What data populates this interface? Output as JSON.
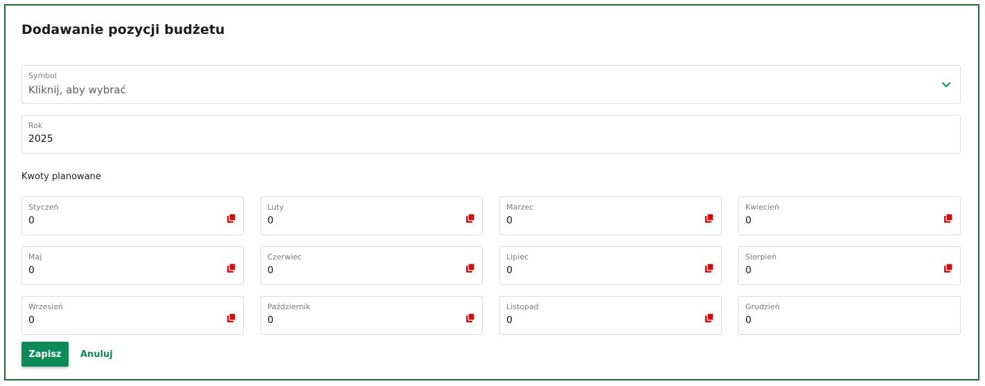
{
  "form": {
    "title": "Dodawanie pozycji budżetu",
    "symbol": {
      "label": "Symbol",
      "placeholder": "Kliknij, aby wybrać"
    },
    "year": {
      "label": "Rok",
      "value": "2025"
    },
    "section_title": "Kwoty planowane",
    "months": [
      {
        "label": "Styczeń",
        "value": "0",
        "copy_icon": "copy-icon"
      },
      {
        "label": "Luty",
        "value": "0",
        "copy_icon": "copy-icon"
      },
      {
        "label": "Marzec",
        "value": "0",
        "copy_icon": "copy-icon"
      },
      {
        "label": "Kwiecień",
        "value": "0",
        "copy_icon": "copy-icon"
      },
      {
        "label": "Maj",
        "value": "0",
        "copy_icon": "copy-icon"
      },
      {
        "label": "Czerwiec",
        "value": "0",
        "copy_icon": "copy-icon"
      },
      {
        "label": "Lipiec",
        "value": "0",
        "copy_icon": "copy-icon"
      },
      {
        "label": "Sierpień",
        "value": "0",
        "copy_icon": "copy-icon"
      },
      {
        "label": "Wrzesień",
        "value": "0",
        "copy_icon": "copy-icon"
      },
      {
        "label": "Październik",
        "value": "0",
        "copy_icon": "copy-icon"
      },
      {
        "label": "Listopad",
        "value": "0",
        "copy_icon": "copy-icon"
      },
      {
        "label": "Grudzień",
        "value": "0"
      }
    ],
    "buttons": {
      "save": "Zapisz",
      "cancel": "Anuluj"
    }
  },
  "colors": {
    "accent": "#0d8a55",
    "border": "#1a6a2e",
    "copy_icon": "#d01010"
  }
}
